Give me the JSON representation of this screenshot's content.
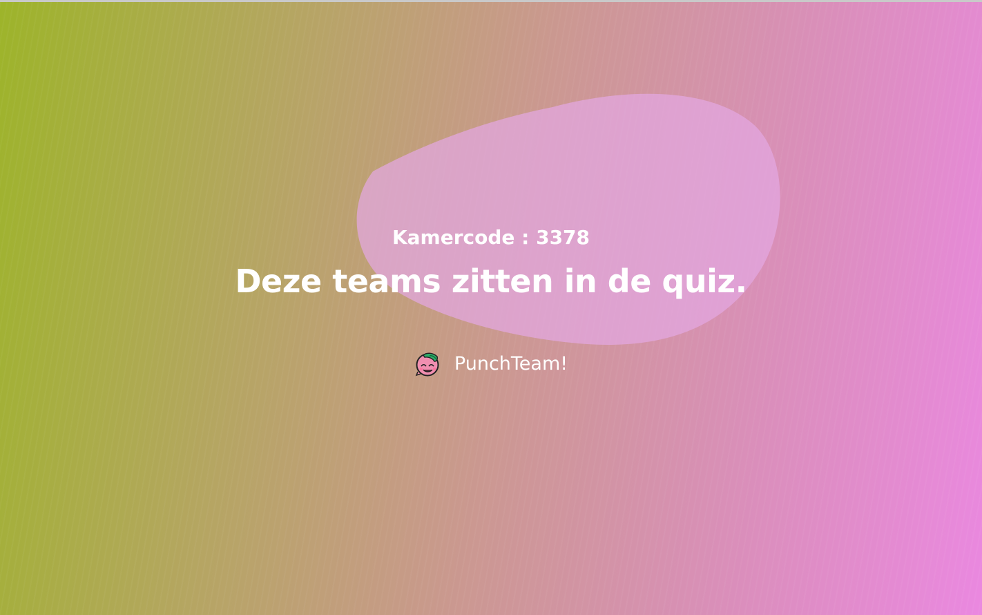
{
  "room": {
    "label": "Kamercode",
    "separator": " : ",
    "code": "3378"
  },
  "headline": "Deze teams zitten in de quiz.",
  "teams": [
    {
      "name": "PunchTeam!",
      "avatar_icon": "smiling-creature-icon"
    }
  ],
  "colors": {
    "gradient_start": "#9db42a",
    "gradient_end": "#ea88e0",
    "blob": "#e3a8e2",
    "text": "#ffffff"
  }
}
